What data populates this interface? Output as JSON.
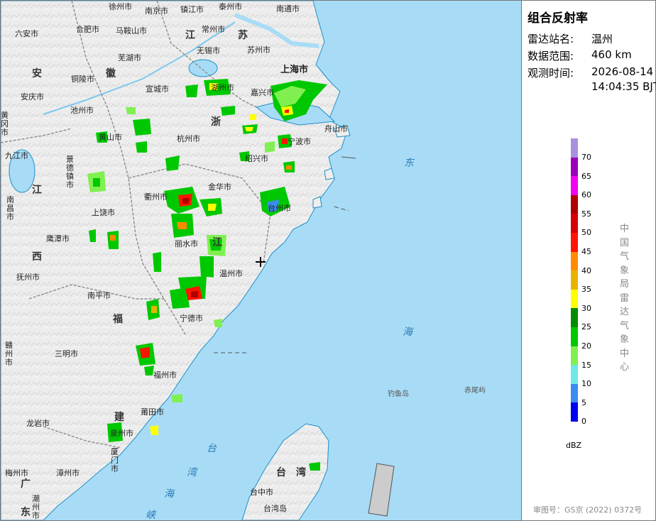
{
  "title": "组合反射率",
  "info": {
    "station_label": "雷达站名:",
    "station_value": "温州",
    "range_label": "数据范围:",
    "range_value": "460 km",
    "time_label": "观测时间:",
    "time_date": "2026-08-14",
    "time_clock": "14:04:35 BJT"
  },
  "legend": {
    "unit": "dBZ",
    "levels": [
      {
        "value": "70",
        "color": "#a98fe0"
      },
      {
        "value": "65",
        "color": "#9b00b8"
      },
      {
        "value": "60",
        "color": "#f000f0"
      },
      {
        "value": "55",
        "color": "#b00000"
      },
      {
        "value": "50",
        "color": "#d80000"
      },
      {
        "value": "45",
        "color": "#ff1400"
      },
      {
        "value": "40",
        "color": "#ff8c00"
      },
      {
        "value": "35",
        "color": "#e8b400"
      },
      {
        "value": "30",
        "color": "#ffff00"
      },
      {
        "value": "25",
        "color": "#008c00"
      },
      {
        "value": "20",
        "color": "#00c800"
      },
      {
        "value": "15",
        "color": "#80f050"
      },
      {
        "value": "10",
        "color": "#70e8e8"
      },
      {
        "value": "5",
        "color": "#3c8cf0"
      },
      {
        "value": "0",
        "color": "#0000f0"
      }
    ]
  },
  "credit": "中国气象局雷达气象中心",
  "approval": "审图号：GS京 (2022) 0372号",
  "map": {
    "provinces": [
      "安",
      "徽",
      "江",
      "苏",
      "浙",
      "江",
      "西",
      "福",
      "建",
      "广",
      "东",
      "台",
      "湾"
    ],
    "seas": [
      "东",
      "海",
      "台",
      "湾",
      "海",
      "峡"
    ],
    "islands": [
      "钓鱼岛",
      "赤尾屿"
    ],
    "cities": [
      "徐州市",
      "南京市",
      "镇江市",
      "泰州市",
      "南通市",
      "六安市",
      "合肥市",
      "马鞍山市",
      "常州市",
      "无锡市",
      "芜湖市",
      "苏州市",
      "上海市",
      "铜陵市",
      "宣城市",
      "湖州市",
      "嘉兴市",
      "安庆市",
      "池州市",
      "杭州市",
      "舟山市",
      "黄山市",
      "宁波市",
      "黄冈市",
      "绍兴市",
      "九江市",
      "景德镇市",
      "金华市",
      "台州市",
      "衢州市",
      "上饶市",
      "南昌市",
      "鹰潭市",
      "丽水市",
      "温州市",
      "抚州市",
      "南平市",
      "宁德市",
      "赣州市",
      "三明市",
      "福州市",
      "莆田市",
      "龙岩市",
      "泉州市",
      "厦门市",
      "漳州市",
      "梅州市",
      "潮州市",
      "台中市",
      "台湾岛"
    ]
  },
  "colors": {
    "sea": "#a8dcf6",
    "land": "#eeeeee",
    "border": "#8c8c8c",
    "coast": "#1f8fc8"
  }
}
